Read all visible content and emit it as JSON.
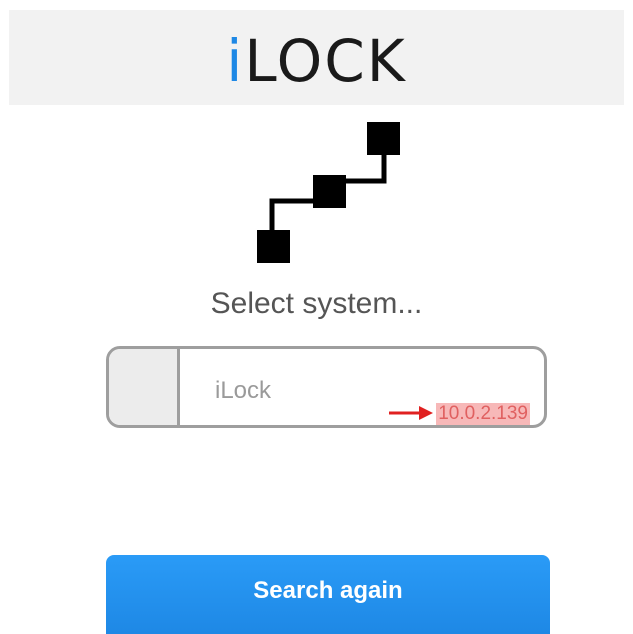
{
  "header": {
    "logo_prefix": "i",
    "logo_rest": "LOCK",
    "accent_color": "#1e88e5"
  },
  "icons": {
    "network": "network-nodes-icon",
    "pointer": "red-arrow-icon"
  },
  "main": {
    "prompt": "Select system..."
  },
  "systems": [
    {
      "name": "iLock",
      "ip": "10.0.2.139"
    }
  ],
  "actions": {
    "search_again_label": "Search again"
  }
}
